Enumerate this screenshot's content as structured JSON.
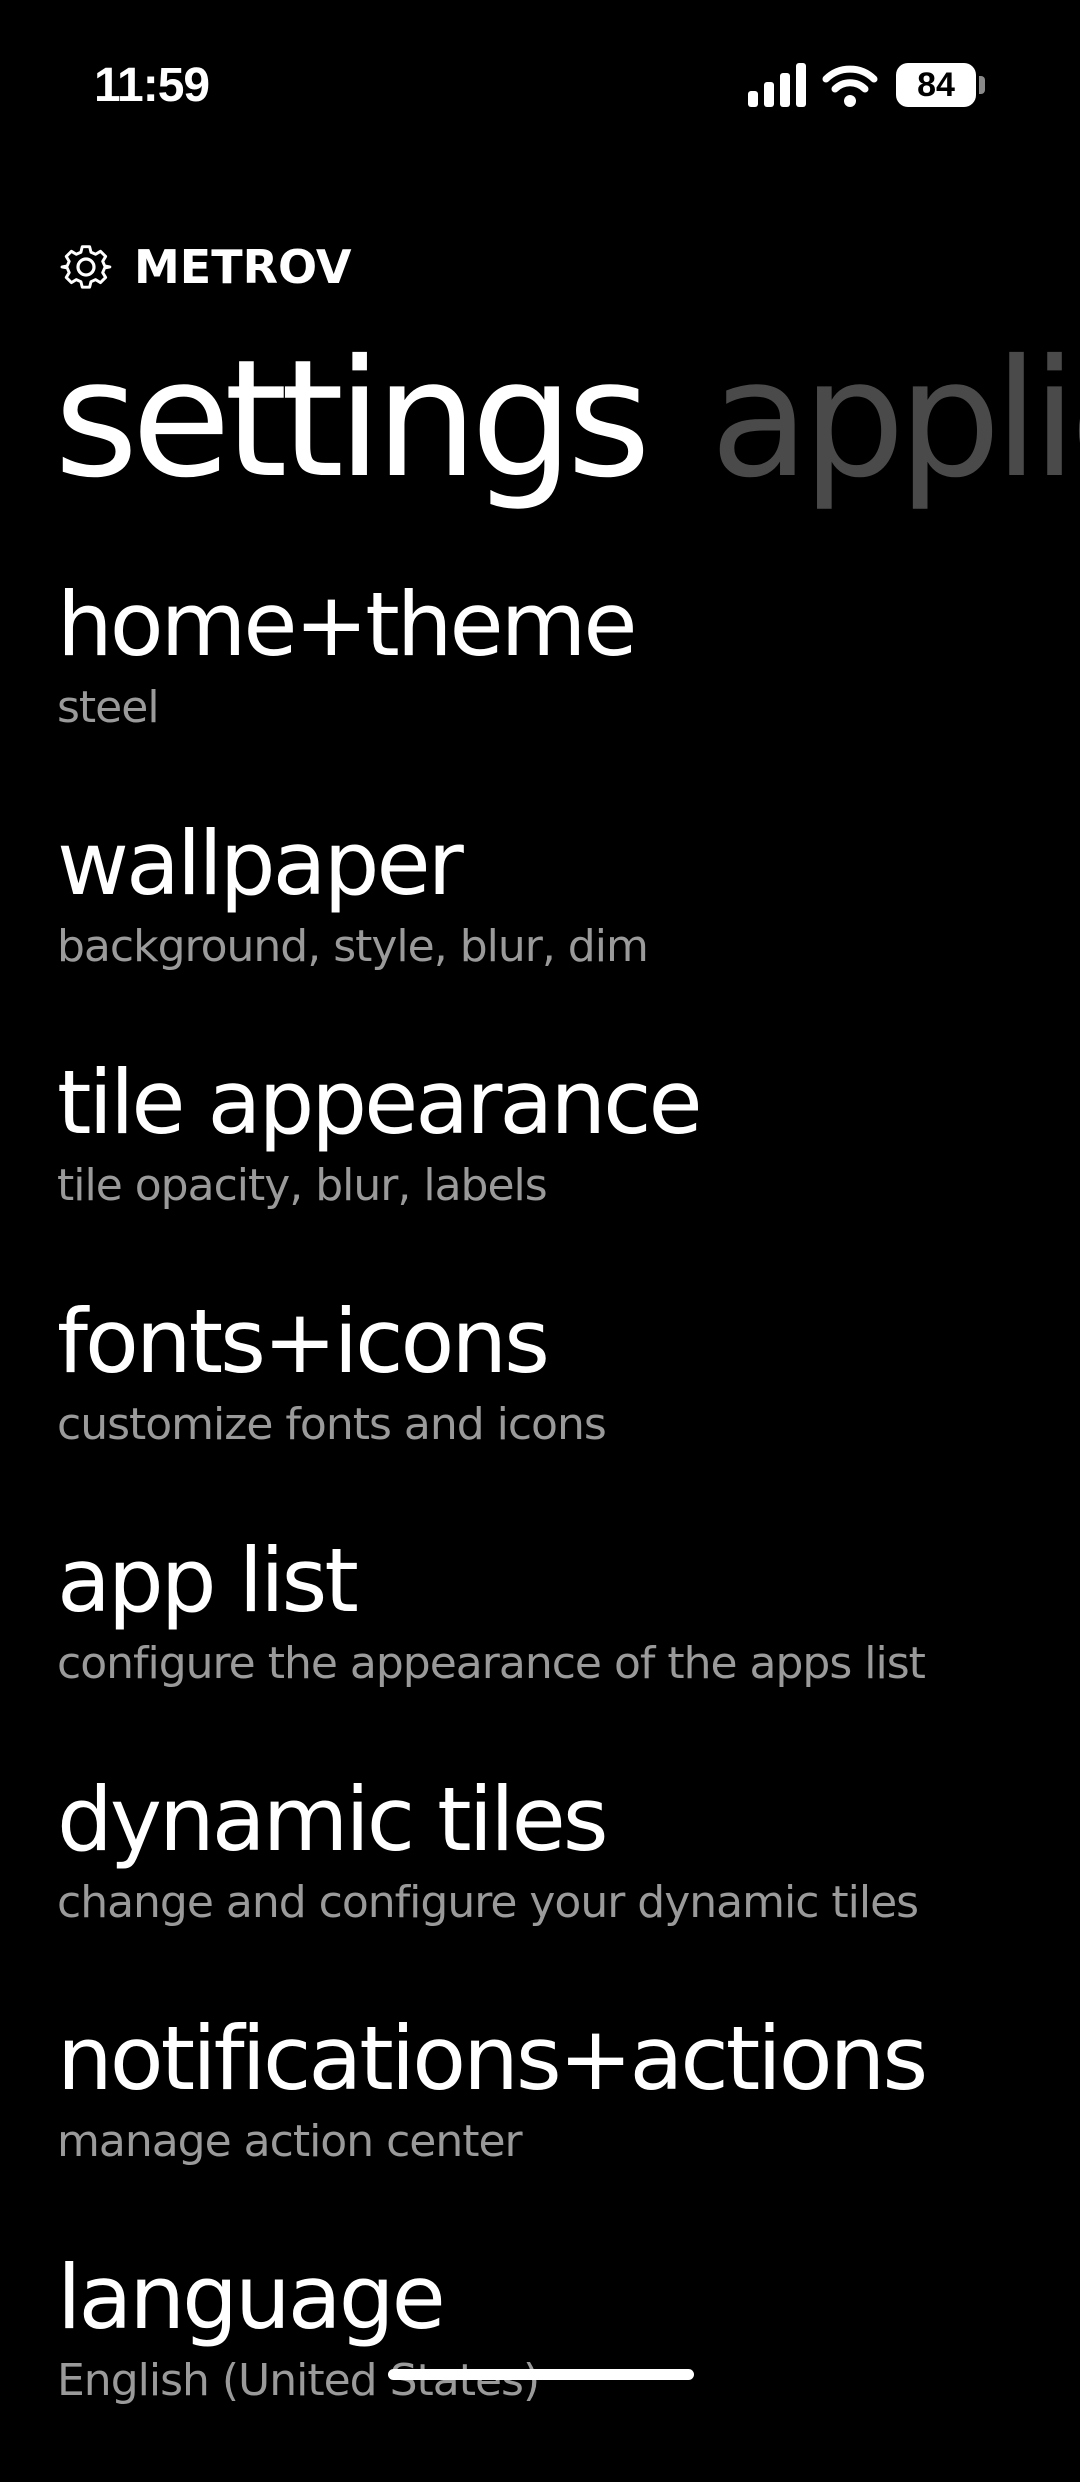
{
  "status_bar": {
    "time": "11:59",
    "battery": "84",
    "icons": [
      "signal-icon",
      "wifi-icon",
      "battery-icon"
    ]
  },
  "header": {
    "icon": "gear-icon",
    "app_name": "METROV"
  },
  "pivot": {
    "active": "settings",
    "next": "applic"
  },
  "settings": {
    "items": [
      {
        "title": "home+theme",
        "subtitle": "steel"
      },
      {
        "title": "wallpaper",
        "subtitle": "background, style, blur, dim"
      },
      {
        "title": "tile appearance",
        "subtitle": "tile opacity, blur, labels"
      },
      {
        "title": "fonts+icons",
        "subtitle": "customize fonts and icons"
      },
      {
        "title": "app list",
        "subtitle": "configure the appearance of the apps list"
      },
      {
        "title": "dynamic tiles",
        "subtitle": "change and configure your dynamic tiles"
      },
      {
        "title": "notifications+actions",
        "subtitle": "manage action center"
      },
      {
        "title": "language",
        "subtitle": "English (United States)"
      }
    ]
  },
  "colors": {
    "background": "#000000",
    "text_primary": "#ffffff",
    "text_secondary": "#9a9a9a",
    "pivot_inactive": "#4a4a4a"
  }
}
